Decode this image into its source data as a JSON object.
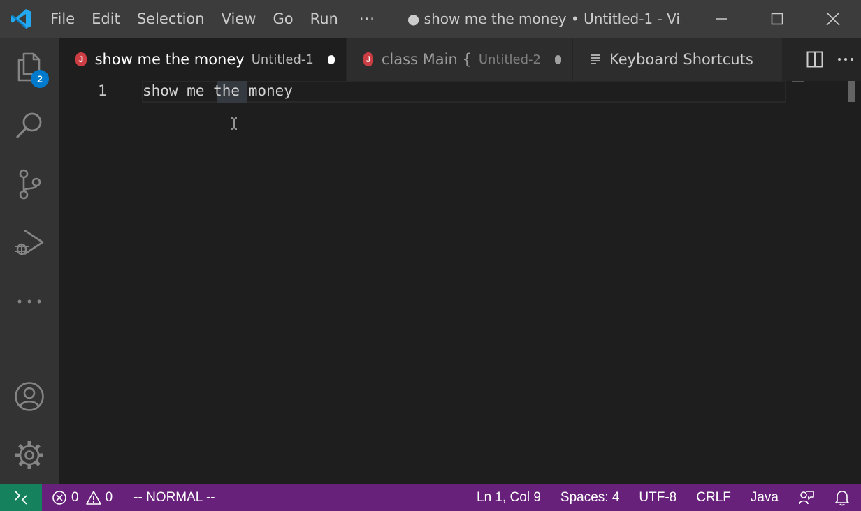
{
  "titlebar": {
    "menu": [
      "File",
      "Edit",
      "Selection",
      "View",
      "Go",
      "Run"
    ],
    "more": "···",
    "window_title": "● show me the money • Untitled-1 - Vis..."
  },
  "activitybar": {
    "explorer_badge": "2"
  },
  "tabs": [
    {
      "icon": "J",
      "label": "show me the money",
      "description": "Untitled-1",
      "active": true,
      "dirty": true
    },
    {
      "icon": "J",
      "label": "class Main {",
      "description": "Untitled-2",
      "active": false,
      "dirty": true
    },
    {
      "icon": "keyboard-shortcuts-icon",
      "label": "Keyboard Shortcuts",
      "active": false
    }
  ],
  "editor": {
    "line_number": "1",
    "code": "show me the money"
  },
  "statusbar": {
    "errors": "0",
    "warnings": "0",
    "mode": "-- NORMAL --",
    "position": "Ln 1, Col 9",
    "spaces": "Spaces: 4",
    "encoding": "UTF-8",
    "eol": "CRLF",
    "language": "Java"
  },
  "colors": {
    "titlebar": "#3c3c3c",
    "activitybar": "#333333",
    "editor": "#1e1e1e",
    "statusbar": "#68217a",
    "remote": "#16825d",
    "badge": "#007acc",
    "java_icon": "#cc3e44"
  }
}
